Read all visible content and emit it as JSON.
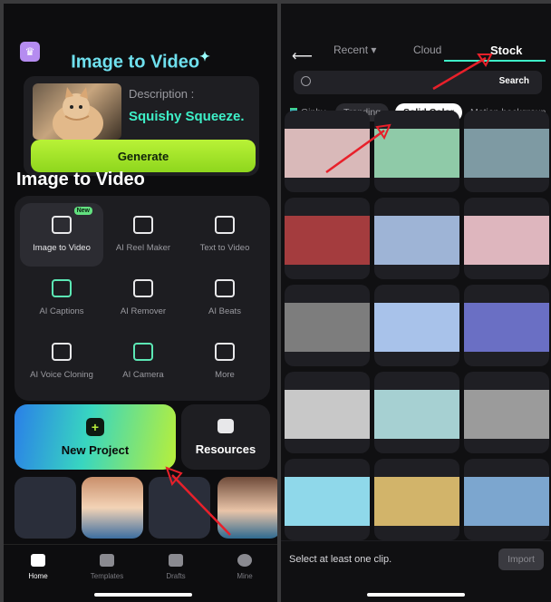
{
  "left": {
    "hero_title": "Image to Video",
    "description_label": "Description :",
    "description_value": "Squishy Squeeze.",
    "generate_label": "Generate",
    "section_title": "Image to Video",
    "tools": [
      {
        "label": "Image to Video",
        "badge": "New",
        "icon": "image-to-video-icon"
      },
      {
        "label": "AI Reel Maker",
        "icon": "reel-maker-icon"
      },
      {
        "label": "Text  to Video",
        "icon": "text-to-video-icon"
      },
      {
        "label": "AI Captions",
        "icon": "captions-icon"
      },
      {
        "label": "AI Remover",
        "icon": "remover-icon"
      },
      {
        "label": "AI Beats",
        "icon": "beats-icon"
      },
      {
        "label": "AI Voice Cloning",
        "icon": "voice-cloning-icon"
      },
      {
        "label": "AI Camera",
        "icon": "camera-icon"
      },
      {
        "label": "More",
        "icon": "more-grid-icon"
      }
    ],
    "new_project_label": "New Project",
    "resources_label": "Resources",
    "nav": [
      {
        "label": "Home",
        "icon": "home-icon"
      },
      {
        "label": "Templates",
        "icon": "templates-icon"
      },
      {
        "label": "Drafts",
        "icon": "drafts-icon"
      },
      {
        "label": "Mine",
        "icon": "profile-icon"
      }
    ]
  },
  "right": {
    "tabs": [
      "Recent ▾",
      "Cloud",
      "Stock"
    ],
    "search_button": "Search",
    "chips": [
      "Giphy",
      "Trending",
      "Solid Color",
      "Motion backgroun"
    ],
    "swatches": [
      "#d9b9b9",
      "#8fcaa8",
      "#7e9aa3",
      "#a43c3e",
      "#9eb4d6",
      "#deb6be",
      "#7d7d7d",
      "#a8c2ea",
      "#6a6fc4",
      "#c8c8c8",
      "#a6d0d2",
      "#9b9b9b",
      "#8fd8ea",
      "#d2b46a",
      "#7ca6cf"
    ],
    "footer_message": "Select at least one clip.",
    "import_label": "Import"
  },
  "accent_color": "#3ef0c8",
  "arrow_color": "#e8202a"
}
